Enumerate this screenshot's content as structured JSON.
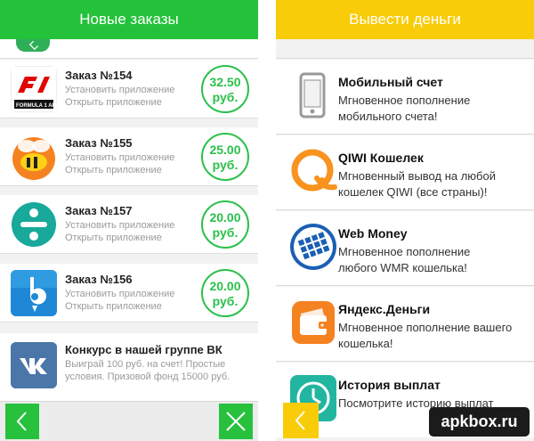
{
  "left_panel": {
    "header_title": "Новые заказы",
    "orders": [
      {
        "title": "Заказ №154",
        "line1": "Установить приложение",
        "line2": "Открыть приложение",
        "price_value": "32.50",
        "price_unit": "руб.",
        "icon": "formula1-app-icon"
      },
      {
        "title": "Заказ №155",
        "line1": "Установить приложение",
        "line2": "Открыть приложение",
        "price_value": "25.00",
        "price_unit": "руб.",
        "icon": "bee-app-icon"
      },
      {
        "title": "Заказ №157",
        "line1": "Установить приложение",
        "line2": "Открыть приложение",
        "price_value": "20.00",
        "price_unit": "руб.",
        "icon": "plus-app-icon"
      },
      {
        "title": "Заказ №156",
        "line1": "Установить приложение",
        "line2": "Открыть приложение",
        "price_value": "20.00",
        "price_unit": "руб.",
        "icon": "map-pin-app-icon"
      }
    ],
    "contest": {
      "title": "Конкурс в нашей группе ВК",
      "desc_line1": "Выиграй 100 руб. на счет! Простые",
      "desc_line2": "условия. Призовой фонд 15000 руб.",
      "icon": "vk-icon"
    },
    "footer": {
      "back_icon": "chevron-left-icon",
      "close_icon": "close-icon"
    },
    "colors": {
      "accent": "#23c23a"
    }
  },
  "right_panel": {
    "header_title": "Вывести деньги",
    "options": [
      {
        "title": "Мобильный  счет",
        "line1": "Мгновенное пополнение",
        "line2": "мобильного счета!",
        "icon": "mobile-phone-icon"
      },
      {
        "title": "QIWI Кошелек",
        "line1": "Мгновенный вывод на любой",
        "line2": "кошелек QIWI (все страны)!",
        "icon": "qiwi-icon"
      },
      {
        "title": "Web Money",
        "line1": "Мгновенное пополнение",
        "line2": "любого WMR кошелька!",
        "icon": "webmoney-icon"
      },
      {
        "title": "Яндекс.Деньги",
        "line1": "Мгновенное пополнение вашего",
        "line2": "кошелька!",
        "icon": "yandex-money-icon"
      },
      {
        "title": "История выплат",
        "line1": "Посмотрите историю выплат",
        "line2": "",
        "icon": "clock-icon"
      }
    ],
    "footer": {
      "back_icon": "chevron-left-icon"
    },
    "colors": {
      "accent": "#f9cc0a"
    }
  },
  "watermark": "apkbox.ru"
}
